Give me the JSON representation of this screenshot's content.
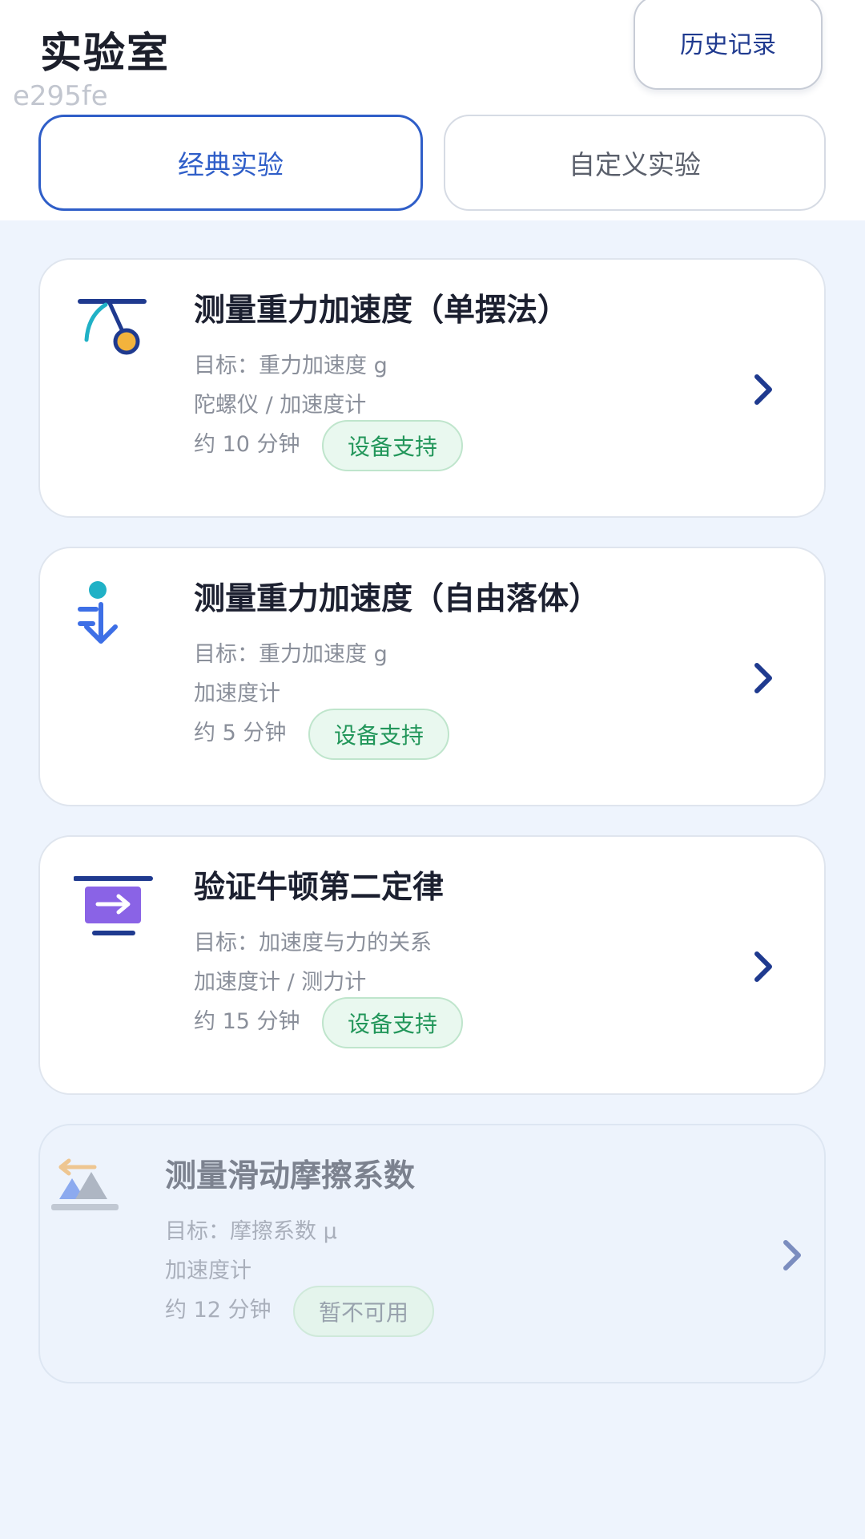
{
  "header": {
    "title": "实验室",
    "id_text": "e295fe",
    "history_label": "历史记录"
  },
  "tabs": [
    {
      "label": "经典实验",
      "active": true
    },
    {
      "label": "自定义实验",
      "active": false
    }
  ],
  "experiments": [
    {
      "title": "测量重力加速度（单摆法）",
      "goal": "目标：重力加速度 g",
      "sensors": "陀螺仪 / 加速度计",
      "duration": "约 10 分钟",
      "badge": "设备支持",
      "icon": "pendulum-icon",
      "available": true
    },
    {
      "title": "测量重力加速度（自由落体）",
      "goal": "目标：重力加速度 g",
      "sensors": "加速度计",
      "duration": "约 5 分钟",
      "badge": "设备支持",
      "icon": "free-fall-icon",
      "available": true
    },
    {
      "title": "验证牛顿第二定律",
      "goal": "目标：加速度与力的关系",
      "sensors": "加速度计 / 测力计",
      "duration": "约 15 分钟",
      "badge": "设备支持",
      "icon": "force-arrow-icon",
      "available": true
    },
    {
      "title": "测量滑动摩擦系数",
      "goal": "目标：摩擦系数 μ",
      "sensors": "加速度计",
      "duration": "约 12 分钟",
      "badge": "暂不可用",
      "icon": "friction-slope-icon",
      "available": false
    }
  ],
  "colors": {
    "accent": "#2f5ec8",
    "badge_green": "#22965a",
    "background": "#eef4fd"
  }
}
